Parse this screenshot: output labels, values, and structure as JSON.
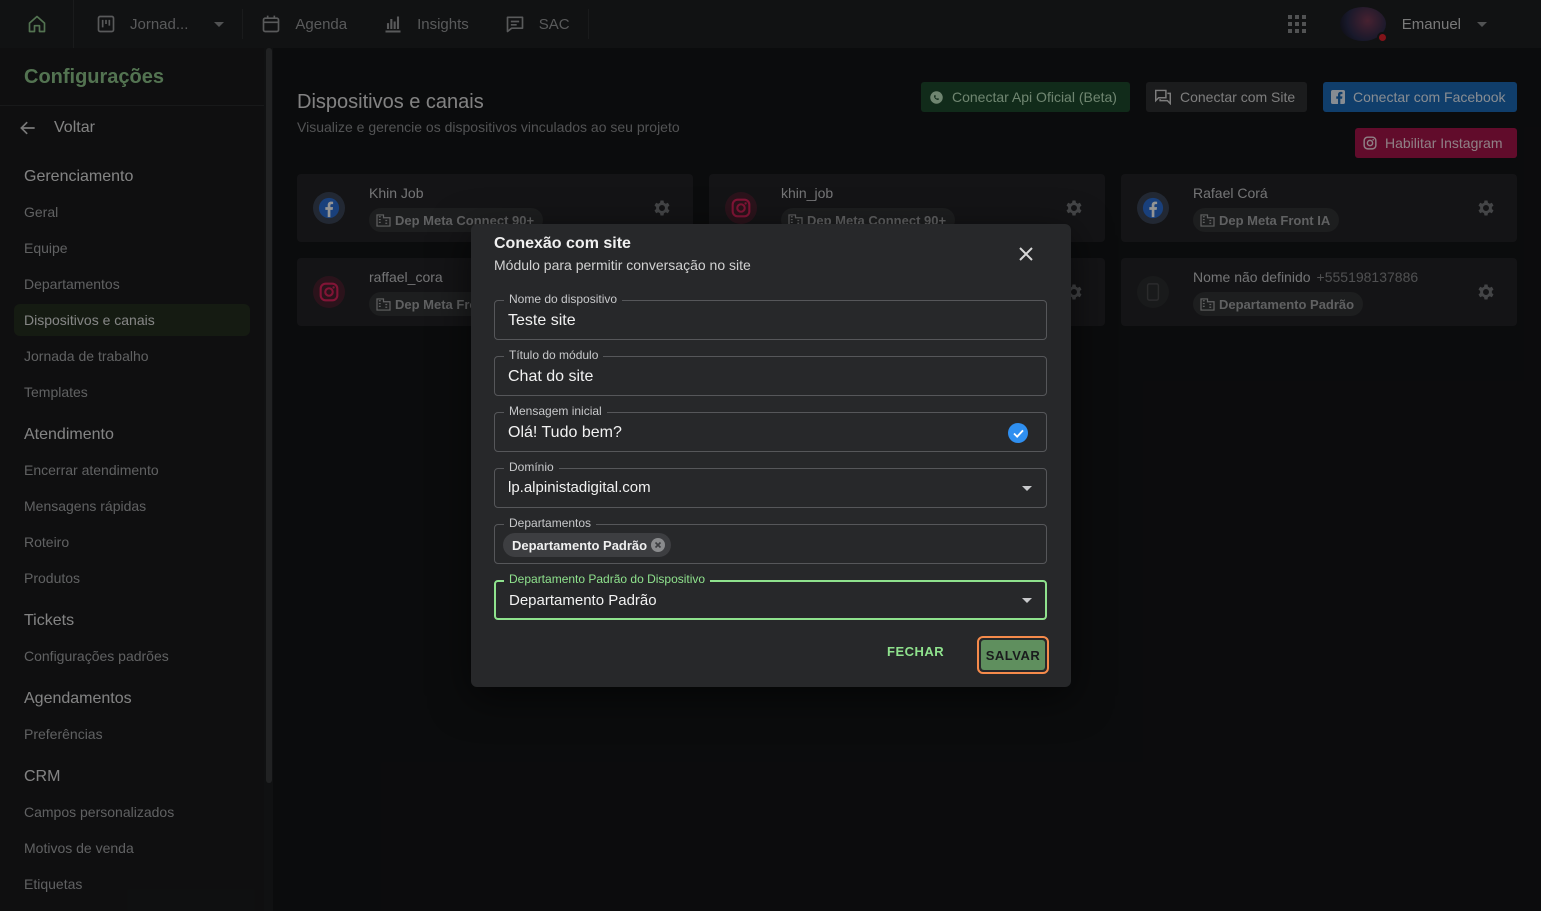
{
  "topbar": {
    "items": [
      {
        "label": "Jornad...",
        "icon": "kanban-icon"
      },
      {
        "label": "Agenda",
        "icon": "calendar-icon"
      },
      {
        "label": "Insights",
        "icon": "bar-chart-icon"
      },
      {
        "label": "SAC",
        "icon": "chat-icon"
      }
    ],
    "user_name": "Emanuel"
  },
  "sidebar": {
    "title": "Configurações",
    "back_label": "Voltar",
    "sections": [
      {
        "title": "Gerenciamento",
        "items": [
          "Geral",
          "Equipe",
          "Departamentos",
          "Dispositivos e canais",
          "Jornada de trabalho",
          "Templates"
        ]
      },
      {
        "title": "Atendimento",
        "items": [
          "Encerrar atendimento",
          "Mensagens rápidas",
          "Roteiro",
          "Produtos"
        ]
      },
      {
        "title": "Tickets",
        "items": [
          "Configurações padrões"
        ]
      },
      {
        "title": "Agendamentos",
        "items": [
          "Preferências"
        ]
      },
      {
        "title": "CRM",
        "items": [
          "Campos personalizados",
          "Motivos de venda",
          "Etiquetas"
        ]
      }
    ],
    "active_item": "Dispositivos e canais"
  },
  "header": {
    "title": "Dispositivos e canais",
    "subtitle": "Visualize e gerencie os dispositivos vinculados ao seu projeto",
    "buttons": {
      "api": "Conectar Api Oficial (Beta)",
      "site": "Conectar com Site",
      "facebook": "Conectar com Facebook",
      "instagram": "Habilitar Instagram"
    }
  },
  "devices": [
    {
      "name": "Khin Job",
      "department": "Dep Meta Connect 90+",
      "type": "facebook"
    },
    {
      "name": "khin_job",
      "department": "Dep Meta Connect 90+",
      "type": "instagram"
    },
    {
      "name": "Rafael Corá",
      "department": "Dep Meta Front IA",
      "type": "facebook"
    },
    {
      "name": "raffael_cora",
      "department": "Dep Meta Fro",
      "type": "instagram"
    },
    {
      "name": "Nome não definido",
      "phone": "+555198137886",
      "department": "Departamento Padrão",
      "type": "phone"
    }
  ],
  "modal": {
    "title": "Conexão com site",
    "subtitle": "Módulo para permitir conversação no site",
    "fields": {
      "device_name": {
        "label": "Nome do dispositivo",
        "value": "Teste site"
      },
      "module_title": {
        "label": "Título do módulo",
        "value": "Chat do site"
      },
      "initial_message": {
        "label": "Mensagem inicial",
        "value": "Olá! Tudo bem?"
      },
      "domain": {
        "label": "Domínio",
        "value": "lp.alpinistadigital.com"
      },
      "departments": {
        "label": "Departamentos",
        "chips": [
          "Departamento Padrão"
        ]
      },
      "default_department": {
        "label": "Departamento Padrão do Dispositivo",
        "value": "Departamento Padrão"
      }
    },
    "close_label": "FECHAR",
    "save_label": "SALVAR"
  },
  "colors": {
    "accent_green": "#8fe28d",
    "facebook_blue": "#1c6bb8",
    "instagram_pink": "#a8154a",
    "whatsapp_green": "#1e4a2d",
    "save_outline": "#f58a4b"
  }
}
